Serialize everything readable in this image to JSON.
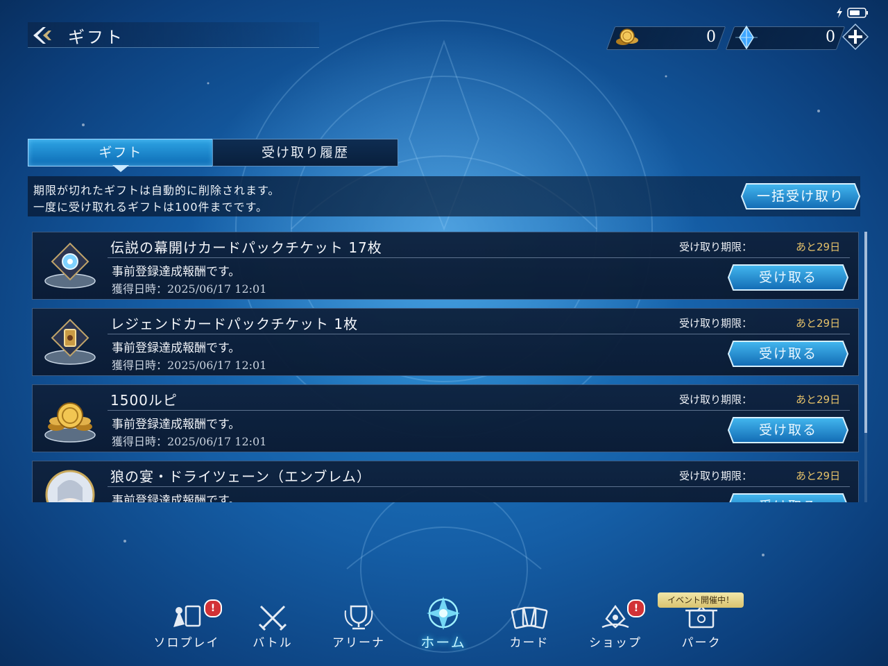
{
  "header": {
    "title": "ギフト"
  },
  "currencies": [
    {
      "icon": "gold-coin-icon",
      "value": "0"
    },
    {
      "icon": "blue-crystal-icon",
      "value": "0"
    }
  ],
  "tabs": [
    {
      "label": "ギフト",
      "active": true
    },
    {
      "label": "受け取り履歴",
      "active": false
    }
  ],
  "notice": {
    "line1": "期限が切れたギフトは自動的に削除されます。",
    "line2": "一度に受け取れるギフトは100件までです。"
  },
  "bulk_receive_label": "一括受け取り",
  "gifts": [
    {
      "name": "伝説の幕開けカードパックチケット 17枚",
      "desc": "事前登録達成報酬です。",
      "date": "獲得日時：2025/06/17 12:01",
      "deadline_label": "受け取り期限：",
      "deadline_value": "あと29日",
      "button": "受け取る",
      "icon": "legend-ticket-icon"
    },
    {
      "name": "レジェンドカードパックチケット 1枚",
      "desc": "事前登録達成報酬です。",
      "date": "獲得日時：2025/06/17 12:01",
      "deadline_label": "受け取り期限：",
      "deadline_value": "あと29日",
      "button": "受け取る",
      "icon": "card-pack-ticket-icon"
    },
    {
      "name": "1500ルピ",
      "desc": "事前登録達成報酬です。",
      "date": "獲得日時：2025/06/17 12:01",
      "deadline_label": "受け取り期限：",
      "deadline_value": "あと29日",
      "button": "受け取る",
      "icon": "gold-coins-icon"
    },
    {
      "name": "狼の宴・ドライツェーン（エンブレム）",
      "desc": "事前登録達成報酬です。",
      "date": "",
      "deadline_label": "受け取り期限：",
      "deadline_value": "あと29日",
      "button": "受け取る",
      "icon": "emblem-portrait-icon"
    }
  ],
  "nav": [
    {
      "label": "ソロプレイ",
      "icon": "solo-play-icon",
      "badge": "!"
    },
    {
      "label": "バトル",
      "icon": "crossed-swords-icon"
    },
    {
      "label": "アリーナ",
      "icon": "trophy-icon"
    },
    {
      "label": "ホーム",
      "icon": "home-crest-icon",
      "active": true
    },
    {
      "label": "カード",
      "icon": "cards-icon"
    },
    {
      "label": "ショップ",
      "icon": "shop-icon",
      "badge": "!"
    },
    {
      "label": "パーク",
      "icon": "park-icon"
    }
  ],
  "event_badge": "イベント開催中！",
  "colors": {
    "accent": "#2ea4e4",
    "gold": "#e6c26a",
    "badge_red": "#d23236"
  }
}
